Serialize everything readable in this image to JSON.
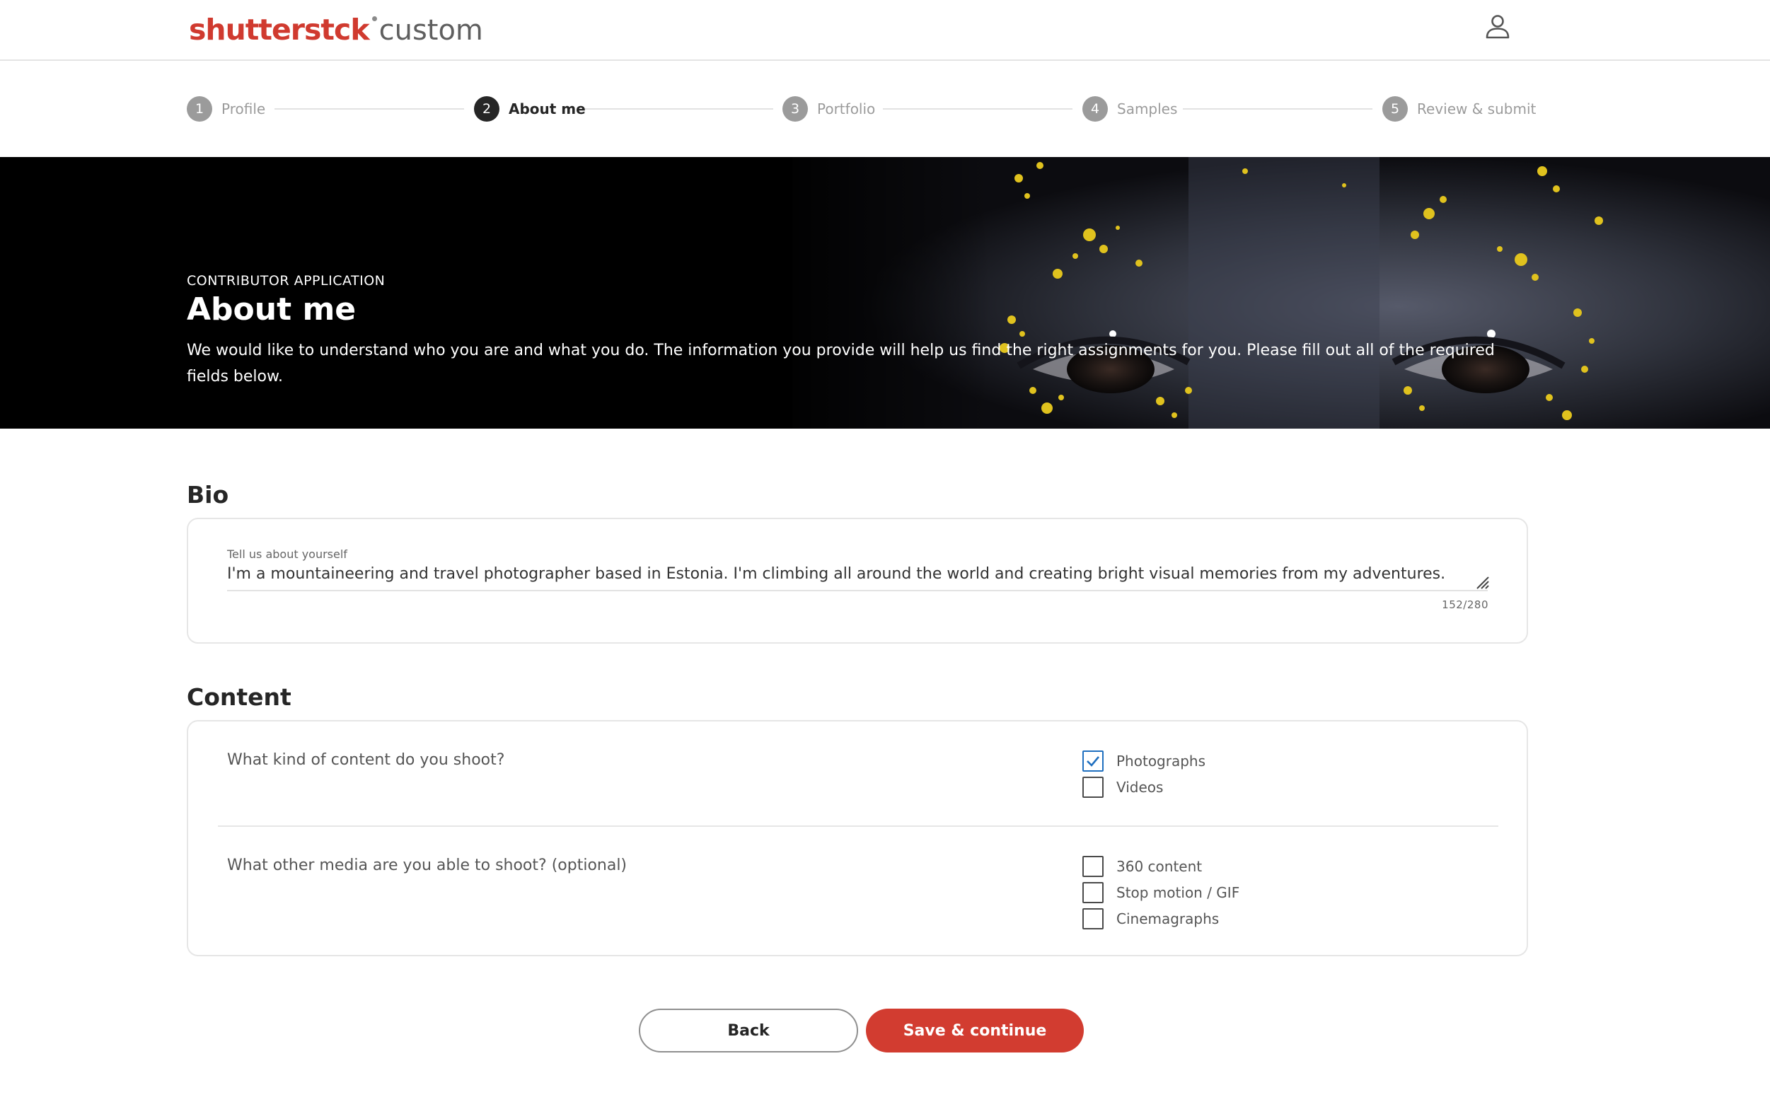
{
  "header": {
    "brand": "shutterst",
    "brand_suffix": "ck",
    "product": "custom",
    "user_icon": "user-icon"
  },
  "stepper": {
    "current_step": 2,
    "steps": [
      {
        "number": "1",
        "label": "Profile"
      },
      {
        "number": "2",
        "label": "About me"
      },
      {
        "number": "3",
        "label": "Portfolio"
      },
      {
        "number": "4",
        "label": "Samples"
      },
      {
        "number": "5",
        "label": "Review & submit"
      }
    ]
  },
  "hero": {
    "eyebrow": "CONTRIBUTOR APPLICATION",
    "title": "About me",
    "description": "We would like to understand who you are and what you do. The information you provide will help us find the right assignments for you. Please fill out all of the required fields below."
  },
  "bio": {
    "section_title": "Bio",
    "field_label": "Tell us about yourself",
    "value": "I'm a mountaineering and travel photographer based in Estonia. I'm climbing all around the world and creating bright visual memories from my adventures.",
    "char_count": "152/280"
  },
  "content": {
    "section_title": "Content",
    "question_1": "What kind of content do you shoot?",
    "options_1": [
      {
        "label": "Photographs",
        "checked": true
      },
      {
        "label": "Videos",
        "checked": false
      }
    ],
    "question_2": "What other media are you able to shoot? (optional)",
    "options_2": [
      {
        "label": "360 content",
        "checked": false
      },
      {
        "label": "Stop motion / GIF",
        "checked": false
      },
      {
        "label": "Cinemagraphs",
        "checked": false
      }
    ]
  },
  "actions": {
    "back_label": "Back",
    "save_label": "Save & continue"
  },
  "colors": {
    "brand_red": "#d03a2f",
    "button_red": "#d23c30",
    "checkbox_checked": "#1f6fbf",
    "active_step": "#262626",
    "inactive_step": "#9b9b9b"
  }
}
